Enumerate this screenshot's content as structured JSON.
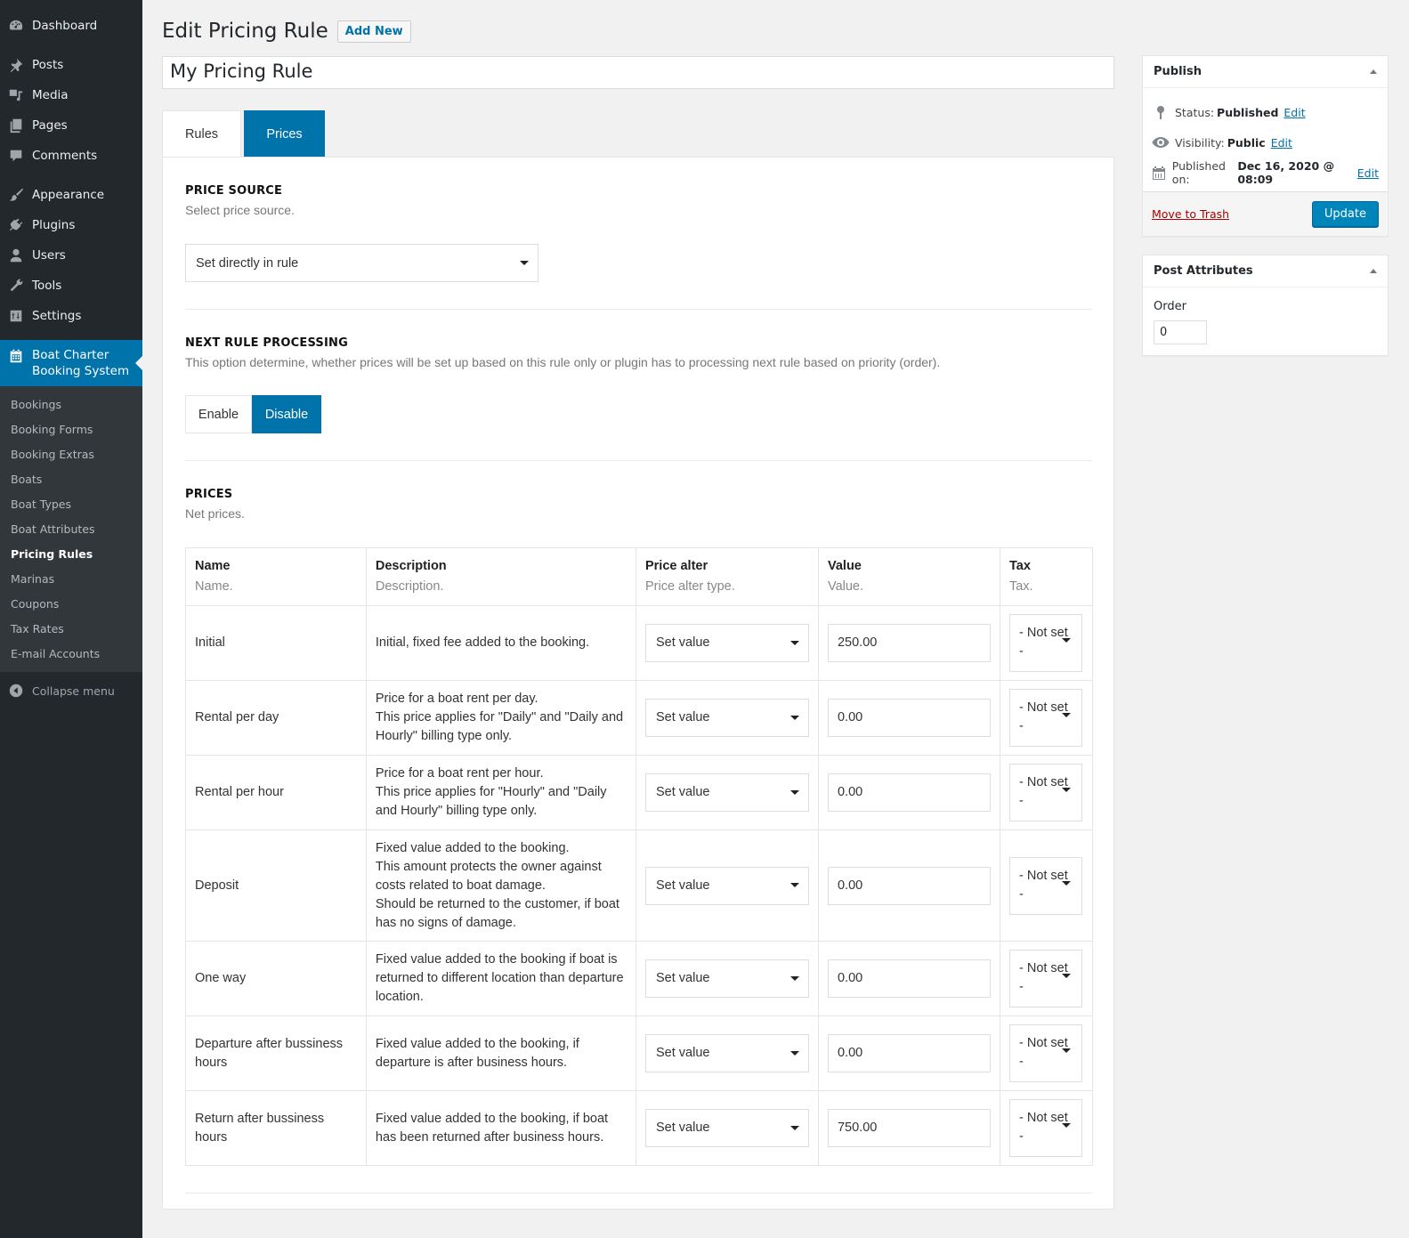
{
  "sidebar": {
    "items": [
      {
        "label": "Dashboard",
        "icon": "dashboard-icon"
      },
      {
        "label": "Posts",
        "icon": "pin-icon"
      },
      {
        "label": "Media",
        "icon": "media-icon"
      },
      {
        "label": "Pages",
        "icon": "pages-icon"
      },
      {
        "label": "Comments",
        "icon": "comment-icon"
      },
      {
        "label": "Appearance",
        "icon": "paintbrush-icon"
      },
      {
        "label": "Plugins",
        "icon": "plug-icon"
      },
      {
        "label": "Users",
        "icon": "user-icon"
      },
      {
        "label": "Tools",
        "icon": "wrench-icon"
      },
      {
        "label": "Settings",
        "icon": "settings-icon"
      }
    ],
    "current": {
      "label_line1": "Boat Charter",
      "label_line2": "Booking System",
      "icon": "calendar-icon"
    },
    "submenu": [
      "Bookings",
      "Booking Forms",
      "Booking Extras",
      "Boats",
      "Boat Types",
      "Boat Attributes",
      "Pricing Rules",
      "Marinas",
      "Coupons",
      "Tax Rates",
      "E-mail Accounts"
    ],
    "active_submenu": "Pricing Rules",
    "collapse_label": "Collapse menu"
  },
  "header": {
    "title": "Edit Pricing Rule",
    "add_new": "Add New"
  },
  "post_title": "My Pricing Rule",
  "tabs": [
    {
      "label": "Rules",
      "active": false
    },
    {
      "label": "Prices",
      "active": true
    }
  ],
  "price_source": {
    "title": "PRICE SOURCE",
    "description": "Select price source.",
    "selected": "Set directly in rule"
  },
  "next_rule": {
    "title": "NEXT RULE PROCESSING",
    "description": "This option determine, whether prices will be set up based on this rule only or plugin has to processing next rule based on priority (order).",
    "options": [
      "Enable",
      "Disable"
    ],
    "selected": "Disable"
  },
  "prices": {
    "title": "PRICES",
    "description": "Net prices.",
    "columns": [
      {
        "label": "Name",
        "desc": "Name."
      },
      {
        "label": "Description",
        "desc": "Description."
      },
      {
        "label": "Price alter",
        "desc": "Price alter type."
      },
      {
        "label": "Value",
        "desc": "Value."
      },
      {
        "label": "Tax",
        "desc": "Tax."
      }
    ],
    "rows": [
      {
        "name": "Initial",
        "description": [
          "Initial, fixed fee added to the booking."
        ],
        "alter": "Set value",
        "value": "250.00",
        "tax": "- Not set -"
      },
      {
        "name": "Rental per day",
        "description": [
          "Price for a boat rent per day.",
          "This price applies for \"Daily\" and \"Daily and Hourly\" billing type only."
        ],
        "alter": "Set value",
        "value": "0.00",
        "tax": "- Not set -"
      },
      {
        "name": "Rental per hour",
        "description": [
          "Price for a boat rent per hour.",
          "This price applies for \"Hourly\" and \"Daily and Hourly\" billing type only."
        ],
        "alter": "Set value",
        "value": "0.00",
        "tax": "- Not set -"
      },
      {
        "name": "Deposit",
        "description": [
          "Fixed value added to the booking.",
          "This amount protects the owner against costs related to boat damage.",
          "Should be returned to the customer, if boat has no signs of damage."
        ],
        "alter": "Set value",
        "value": "0.00",
        "tax": "- Not set -"
      },
      {
        "name": "One way",
        "description": [
          "Fixed value added to the booking if boat is returned to different location than departure location."
        ],
        "alter": "Set value",
        "value": "0.00",
        "tax": "- Not set -"
      },
      {
        "name": "Departure after bussiness hours",
        "description": [
          "Fixed value added to the booking, if departure is after business hours."
        ],
        "alter": "Set value",
        "value": "0.00",
        "tax": "- Not set -"
      },
      {
        "name": "Return after bussiness hours",
        "description": [
          "Fixed value added to the booking, if boat has been returned after business hours."
        ],
        "alter": "Set value",
        "value": "750.00",
        "tax": "- Not set -"
      }
    ]
  },
  "publish": {
    "title": "Publish",
    "status_label": "Status:",
    "status_value": "Published",
    "visibility_label": "Visibility:",
    "visibility_value": "Public",
    "published_label": "Published on:",
    "published_value": "Dec 16, 2020 @ 08:09",
    "edit_label": "Edit",
    "trash_label": "Move to Trash",
    "update_label": "Update"
  },
  "post_attributes": {
    "title": "Post Attributes",
    "order_label": "Order",
    "order_value": "0"
  },
  "colors": {
    "accent": "#0073aa",
    "sidebar_bg": "#23282d",
    "submenu_bg": "#32373c",
    "trash": "#aa0000"
  }
}
